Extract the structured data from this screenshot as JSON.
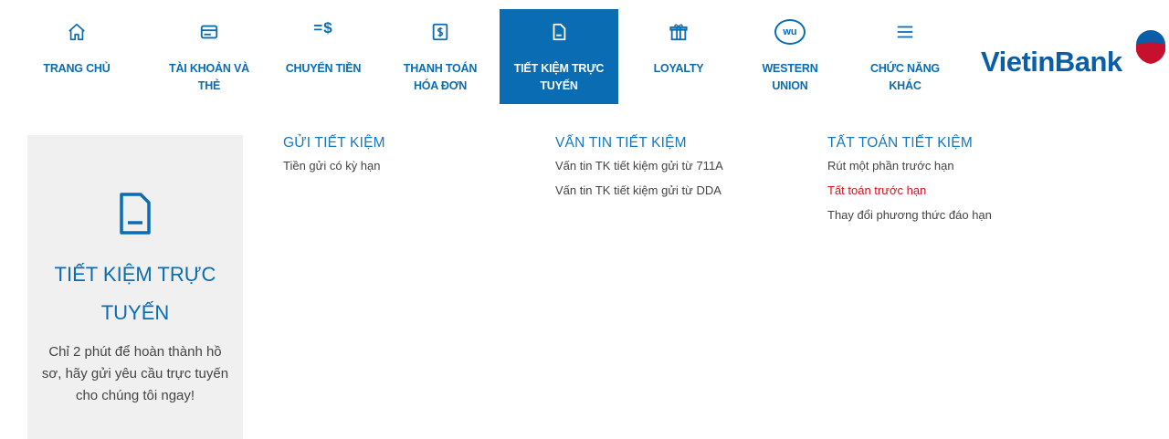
{
  "nav": {
    "items": [
      {
        "label": "TRANG CHỦ"
      },
      {
        "label": "TÀI KHOẢN VÀ THẺ"
      },
      {
        "label": "CHUYỂN TIỀN"
      },
      {
        "label": "THANH TOÁN HÓA ĐƠN"
      },
      {
        "label": "TIẾT KIỆM TRỰC TUYẾN",
        "active": true
      },
      {
        "label": "LOYALTY"
      },
      {
        "label": "WESTERN UNION"
      },
      {
        "label": "CHỨC NĂNG KHÁC"
      }
    ],
    "wu_badge": "wu",
    "transfer_icon_text": "=$"
  },
  "logo": {
    "text": "VietinBank"
  },
  "promo": {
    "title": "TIẾT KIỆM TRỰC TUYẾN",
    "description": "Chỉ 2 phút để hoàn thành hồ sơ, hãy gửi yêu cầu trực tuyến cho chúng tôi ngay!"
  },
  "menu": {
    "columns": [
      {
        "title": "GỬI TIẾT KIỆM",
        "links": [
          "Tiền gửi có kỳ hạn"
        ]
      },
      {
        "title": "VẤN TIN TIẾT KIỆM",
        "links": [
          "Vấn tin TK tiết kiệm gửi từ 711A",
          "Vấn tin TK tiết kiệm gửi từ DDA"
        ]
      },
      {
        "title": "TẤT TOÁN TIẾT KIỆM",
        "links": [
          "Rút một phần trước hạn",
          "Tất toán trước hạn",
          "Thay đổi phương thức đáo hạn"
        ]
      }
    ]
  },
  "colors": {
    "brand": "#0a6cb3",
    "highlight": "#d3141c",
    "logo_red": "#c8102e"
  }
}
